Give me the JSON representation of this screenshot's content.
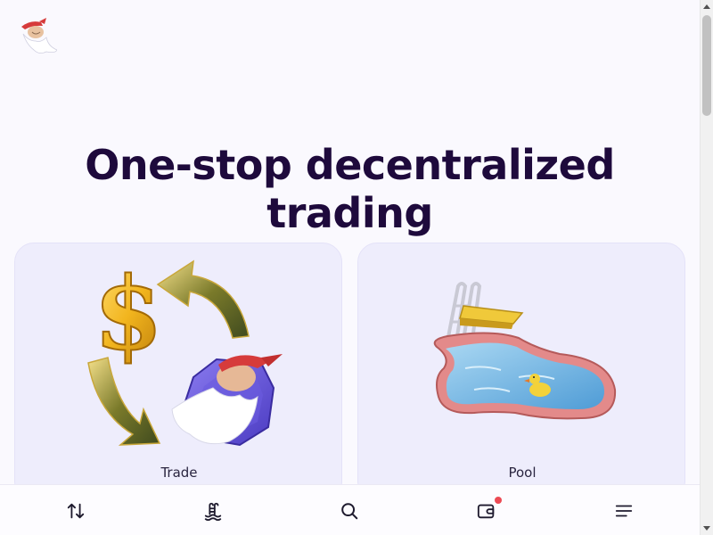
{
  "header": {
    "logo_icon": "bearded-gnome-logo"
  },
  "hero": {
    "headline": "One-stop decentralized trading"
  },
  "cards": [
    {
      "label": "Trade",
      "illustration": "currency-swap-arrows-illustration"
    },
    {
      "label": "Pool",
      "illustration": "swimming-pool-duck-illustration"
    }
  ],
  "bottom_nav": {
    "items": [
      {
        "icon": "swap-arrows-icon"
      },
      {
        "icon": "pool-ladder-icon"
      },
      {
        "icon": "search-icon"
      },
      {
        "icon": "wallet-icon",
        "has_notification": true
      },
      {
        "icon": "menu-icon"
      }
    ]
  },
  "colors": {
    "background": "#faf9fe",
    "headline": "#1e0a3c",
    "card": "#eeedfc",
    "badge": "#ec4a54"
  }
}
